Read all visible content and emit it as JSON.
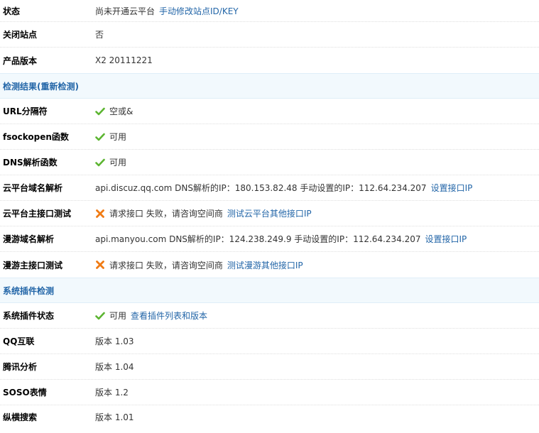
{
  "rows_top": [
    {
      "label": "状态",
      "value": "尚未开通云平台",
      "link": "手动修改站点ID/KEY"
    },
    {
      "label": "关闭站点",
      "value": "否"
    },
    {
      "label": "产品版本",
      "value": "X2 20111221"
    }
  ],
  "section_check": {
    "title": "检测结果(重新检测)"
  },
  "check_rows": [
    {
      "label": "URL分隔符",
      "status": "ok",
      "value": "空或&"
    },
    {
      "label": "fsockopen函数",
      "status": "ok",
      "value": "可用"
    },
    {
      "label": "DNS解析函数",
      "status": "ok",
      "value": "可用"
    },
    {
      "label": "云平台域名解析",
      "text": "api.discuz.qq.com DNS解析的IP：180.153.82.48 手动设置的IP：112.64.234.207",
      "link": "设置接口IP"
    },
    {
      "label": "云平台主接口测试",
      "status": "error",
      "value": "请求接口 失败，请咨询空间商",
      "link": "测试云平台其他接口IP"
    },
    {
      "label": "漫游域名解析",
      "text": "api.manyou.com DNS解析的IP：124.238.249.9 手动设置的IP：112.64.234.207",
      "link": "设置接口IP"
    },
    {
      "label": "漫游主接口测试",
      "status": "error",
      "value": "请求接口 失败，请咨询空间商",
      "link": "测试漫游其他接口IP"
    }
  ],
  "section_plugin": {
    "title": "系统插件检测"
  },
  "plugin_rows": [
    {
      "label": "系统插件状态",
      "status": "ok",
      "value": "可用",
      "link": "查看插件列表和版本"
    },
    {
      "label": "QQ互联",
      "value": "版本 1.03"
    },
    {
      "label": "腾讯分析",
      "value": "版本 1.04"
    },
    {
      "label": "SOSO表情",
      "value": "版本 1.2"
    },
    {
      "label": "纵横搜索",
      "value": "版本 1.01"
    }
  ],
  "colors": {
    "ok": "#5cb531",
    "error": "#f07b14",
    "link": "#2366a8",
    "section_bg": "#f2f9fd"
  },
  "icons": {
    "ok": "check-icon",
    "error": "cross-icon"
  }
}
